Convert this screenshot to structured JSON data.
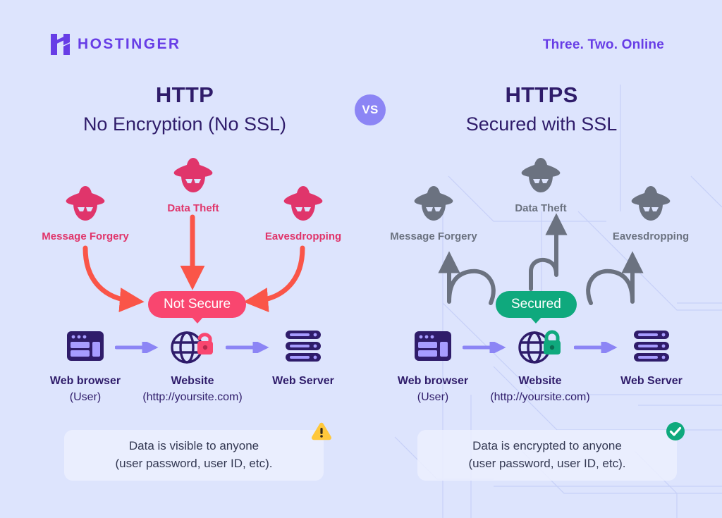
{
  "brand": {
    "name": "HOSTINGER",
    "logo_icon": "hostinger-h-icon",
    "tagline": "Three. Two. Online",
    "accent": "#673de6"
  },
  "colors": {
    "background": "#dde4fd",
    "heading": "#2f1c6a",
    "danger": "#e0356b",
    "danger_pill": "#f9466f",
    "danger_arrow": "#fa5548",
    "success": "#0fa97d",
    "neutral": "#6b7280",
    "flow_arrow": "#8c85f5",
    "warning": "#ffc83c",
    "vs_badge": "#8c85f5"
  },
  "vs_label": "VS",
  "columns": [
    {
      "id": "http",
      "title": "HTTP",
      "subtitle": "No Encryption (No SSL)",
      "status_pill": "Not Secure",
      "status_state": "insecure",
      "threats": [
        {
          "label": "Message Forgery",
          "icon": "hacker-mask-icon",
          "tone": "red"
        },
        {
          "label": "Data Theft",
          "icon": "hacker-mask-icon",
          "tone": "red"
        },
        {
          "label": "Eavesdropping",
          "icon": "hacker-mask-icon",
          "tone": "red"
        }
      ],
      "nodes": [
        {
          "icon": "web-browser-icon",
          "line1": "Web browser",
          "line2": "(User)"
        },
        {
          "icon": "globe-unlocked-icon",
          "line1": "Website",
          "line2": "(http://yoursite.com)"
        },
        {
          "icon": "web-server-icon",
          "line1": "Web Server",
          "line2": ""
        }
      ],
      "note": {
        "icon": "warning-triangle-icon",
        "line1": "Data is visible to anyone",
        "line2": "(user password, user ID, etc)."
      }
    },
    {
      "id": "https",
      "title": "HTTPS",
      "subtitle": "Secured with SSL",
      "status_pill": "Secured",
      "status_state": "secure",
      "threats": [
        {
          "label": "Message Forgery",
          "icon": "hacker-mask-icon",
          "tone": "gray"
        },
        {
          "label": "Data Theft",
          "icon": "hacker-mask-icon",
          "tone": "gray"
        },
        {
          "label": "Eavesdropping",
          "icon": "hacker-mask-icon",
          "tone": "gray"
        }
      ],
      "nodes": [
        {
          "icon": "web-browser-icon",
          "line1": "Web browser",
          "line2": "(User)"
        },
        {
          "icon": "globe-locked-icon",
          "line1": "Website",
          "line2": "(http://yoursite.com)"
        },
        {
          "icon": "web-server-icon",
          "line1": "Web Server",
          "line2": ""
        }
      ],
      "note": {
        "icon": "check-circle-icon",
        "line1": "Data is encrypted to anyone",
        "line2": "(user password, user ID, etc)."
      }
    }
  ]
}
